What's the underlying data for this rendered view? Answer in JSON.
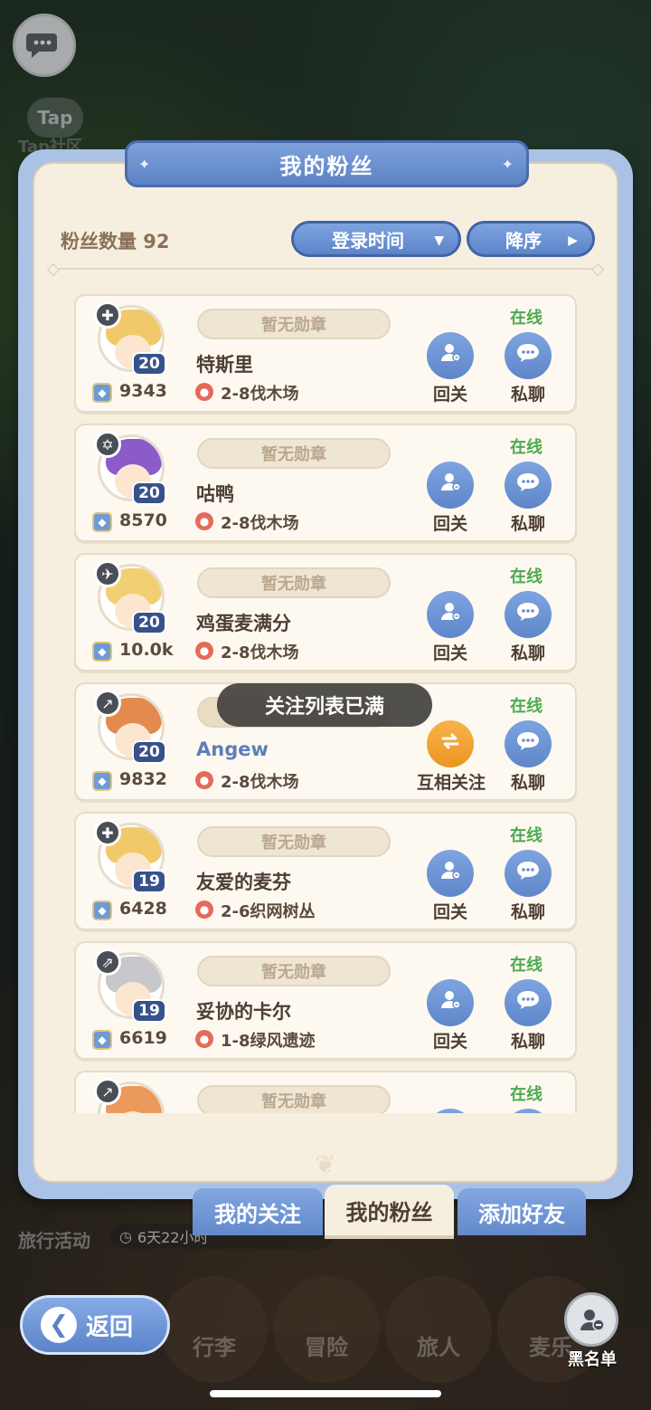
{
  "background": {
    "tap_label": "Tap",
    "tap_community": "Tap社区",
    "travel_activity": "旅行活动",
    "timer": "6天22小时",
    "bottom_tabs": [
      "行李",
      "冒险",
      "旅人",
      "麦乐"
    ]
  },
  "panel": {
    "title": "我的粉丝"
  },
  "header": {
    "fans_count_label": "粉丝数量 92",
    "sort_field": "登录时间",
    "sort_order": "降序"
  },
  "fans": [
    {
      "name": "特斯里",
      "level": "20",
      "power": "9343",
      "location": "2-8伐木场",
      "medal": "暂无勋章",
      "status": "在线",
      "action1": "回关",
      "action2": "私聊",
      "hair": "#f2c96a",
      "class_icon": "✚"
    },
    {
      "name": "咕鸭",
      "level": "20",
      "power": "8570",
      "location": "2-8伐木场",
      "medal": "暂无勋章",
      "status": "在线",
      "action1": "回关",
      "action2": "私聊",
      "hair": "#8a5bc9",
      "class_icon": "✡"
    },
    {
      "name": "鸡蛋麦满分",
      "level": "20",
      "power": "10.0k",
      "location": "2-8伐木场",
      "medal": "暂无勋章",
      "status": "在线",
      "action1": "回关",
      "action2": "私聊",
      "hair": "#f1cf73",
      "class_icon": "✈"
    },
    {
      "name": "Angew",
      "level": "20",
      "power": "9832",
      "location": "2-8伐木场",
      "medal": "",
      "status": "在线",
      "action1": "互相关注",
      "action2": "私聊",
      "hair": "#e58a4f",
      "class_icon": "↗",
      "mutual": true
    },
    {
      "name": "友爱的麦芬",
      "level": "19",
      "power": "6428",
      "location": "2-6织网树丛",
      "medal": "暂无勋章",
      "status": "在线",
      "action1": "回关",
      "action2": "私聊",
      "hair": "#f2c96a",
      "class_icon": "✚"
    },
    {
      "name": "妥协的卡尔",
      "level": "19",
      "power": "6619",
      "location": "1-8绿风遗迹",
      "medal": "暂无勋章",
      "status": "在线",
      "action1": "回关",
      "action2": "私聊",
      "hair": "#c7c7cc",
      "class_icon": "⇗"
    },
    {
      "name": "",
      "level": "",
      "power": "",
      "location": "",
      "medal": "暂无勋章",
      "status": "在线",
      "action1": "",
      "action2": "",
      "hair": "#ec9a5c",
      "class_icon": "↗"
    }
  ],
  "toast": "关注列表已满",
  "tabs": [
    "我的关注",
    "我的粉丝",
    "添加好友"
  ],
  "back_label": "返回",
  "blacklist_label": "黑名单",
  "colors": {
    "accent_blue": "#5f86c9",
    "online_green": "#4caa4f",
    "mutual_orange": "#ec9522"
  }
}
